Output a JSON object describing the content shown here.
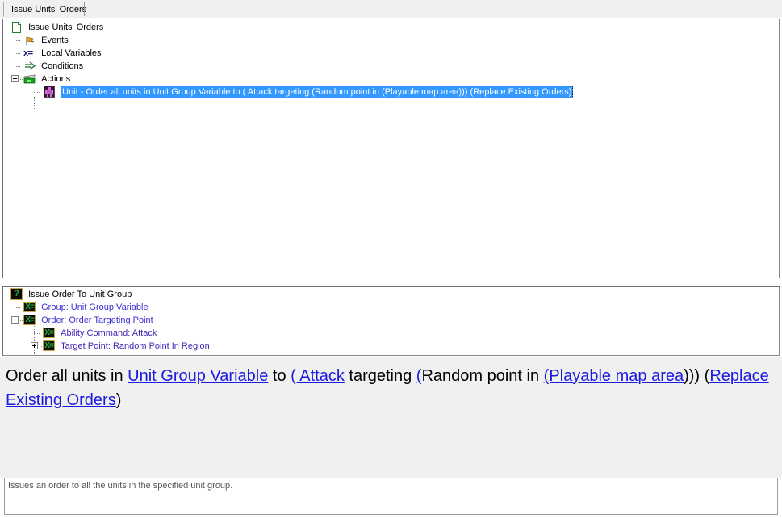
{
  "window": {
    "tab_label": "Issue Units' Orders"
  },
  "upper_tree": {
    "nodes": [
      {
        "label": "Issue Units' Orders",
        "icon": "document-icon"
      },
      {
        "label": "Events",
        "icon": "flag-icon"
      },
      {
        "label": "Local Variables",
        "icon": "variable-icon"
      },
      {
        "label": "Conditions",
        "icon": "arrow-icon"
      },
      {
        "label": "Actions",
        "icon": "clapperboard-icon"
      },
      {
        "label": "Unit - Order all units in Unit Group Variable to ( Attack targeting (Random point in (Playable map area))) (Replace Existing Orders)",
        "icon": "unit-icon"
      }
    ]
  },
  "lower_tree": {
    "nodes": [
      {
        "label": "Issue Order To Unit Group",
        "icon": "question-icon"
      },
      {
        "label": "Group: Unit Group Variable",
        "icon": "variable-green-icon"
      },
      {
        "label": "Order: Order Targeting Point",
        "icon": "variable-green-icon"
      },
      {
        "label": "Ability Command:  Attack",
        "icon": "variable-green-icon"
      },
      {
        "label": "Target Point: Random Point In Region",
        "icon": "variable-green-icon"
      }
    ]
  },
  "description": {
    "segments": [
      {
        "text": "Order all units in ",
        "link": false
      },
      {
        "text": "Unit Group Variable",
        "link": true
      },
      {
        "text": " to ",
        "link": false
      },
      {
        "text": "( Attack",
        "link": true
      },
      {
        "text": " targeting ",
        "link": false
      },
      {
        "text": "(",
        "link": true
      },
      {
        "text": "Random point in ",
        "link": false
      },
      {
        "text": "(Playable map area",
        "link": true
      },
      {
        "text": ")))",
        "link": false
      },
      {
        "text": " (",
        "link": false
      },
      {
        "text": "Replace Existing Orders",
        "link": true
      },
      {
        "text": ")",
        "link": false
      }
    ]
  },
  "status": {
    "text": "Issues an order to all the units in the specified unit group."
  },
  "colors": {
    "selection": "#3399ff",
    "link": "#1a1ae0",
    "tree_blue": "#3b2fd4",
    "panel_bg": "#f0f0f0"
  }
}
